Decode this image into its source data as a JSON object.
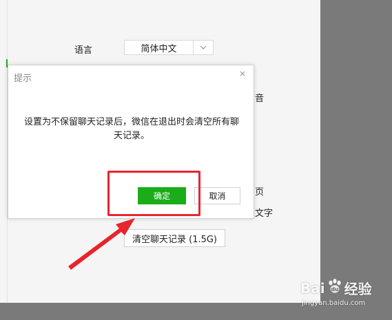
{
  "settings": {
    "language_label": "语言",
    "language_value": "简体中文",
    "peek_texts": [
      "音",
      "页",
      "文字"
    ],
    "clear_history_label": "清空聊天记录 (1.5G)"
  },
  "dialog": {
    "title": "提示",
    "message": "设置为不保留聊天记录后，微信在退出时会清空所有聊天记录。",
    "confirm_label": "确定",
    "cancel_label": "取消"
  },
  "watermark": {
    "brand_left": "Bai",
    "brand_right": "经验",
    "url": "jingyan.baidu.com"
  },
  "colors": {
    "accent_green": "#1aad19",
    "annotation_red": "#e8242d",
    "backdrop_gray": "#7a7a7a"
  }
}
